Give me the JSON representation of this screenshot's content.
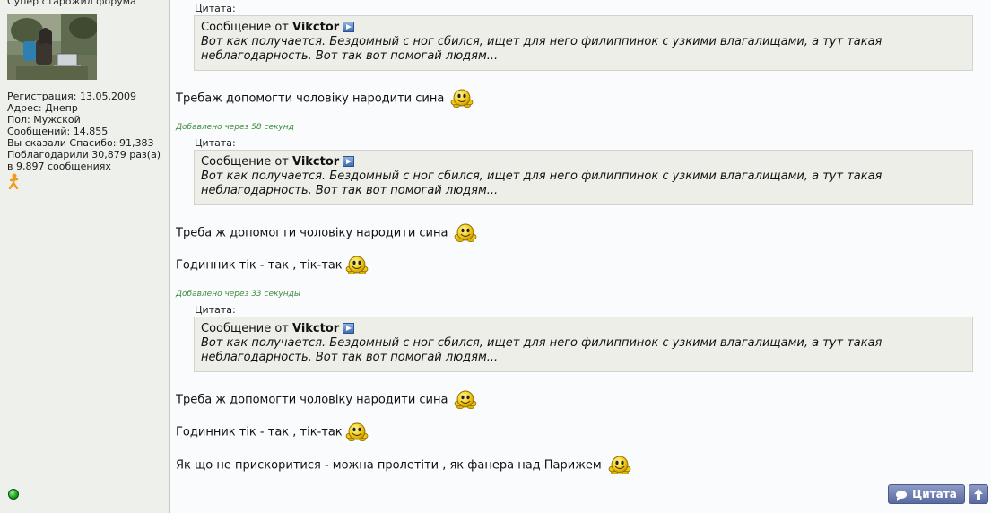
{
  "sidebar": {
    "user_title": "Супер старожил форума",
    "stats": [
      "Регистрация: 13.05.2009",
      "Адрес: Днепр",
      "Пол: Мужской",
      "Сообщений: 14,855",
      "Вы сказали Спасибо: 91,383",
      "Поблагодарили 30,879 раз(а)",
      "в 9,897 сообщениях"
    ]
  },
  "post": {
    "quotes": [
      {
        "label": "Цитата:",
        "prefix": "Сообщение от",
        "author": "Vikctor",
        "line1": "Вот как получается. Бездомный с ног сбился, ищет для него филиппинок с узкими влагалищами, а тут такая",
        "line2": "неблагодарность. Вот так вот помогай людям..."
      },
      {
        "label": "Цитата:",
        "prefix": "Сообщение от",
        "author": "Vikctor",
        "line1": "Вот как получается. Бездомный с ног сбился, ищет для него филиппинок с узкими влагалищами, а тут такая",
        "line2": "неблагодарность. Вот так вот помогай людям..."
      },
      {
        "label": "Цитата:",
        "prefix": "Сообщение от",
        "author": "Vikctor",
        "line1": "Вот как получается. Бездомный с ног сбился, ищет для него филиппинок с узкими влагалищами, а тут такая",
        "line2": "неблагодарность. Вот так вот помогай людям..."
      }
    ],
    "messages": [
      "Требаж допомогти чоловіку народити сина",
      "Треба ж допомогти чоловіку народити сина",
      "Годинник тік - так , тік-так",
      "Треба ж допомогти чоловіку народити сина",
      "Годинник тік - так , тік-так",
      "Як що не прискоритися - можна пролетіти , як фанера над Парижем"
    ],
    "added_notes": [
      "Добавлено через 58 секунд",
      "Добавлено через 33 секунды"
    ]
  },
  "buttons": {
    "quote_label": "Цитата"
  },
  "icons": {
    "view_post": "view-post-arrow-icon",
    "smiley": "laughing-smiley-icon",
    "online": "online-status-icon",
    "reputation": "reputation-figure-icon",
    "top": "arrow-up-icon"
  },
  "colors": {
    "added_note": "#3d8b3d",
    "quote_bg": "#eeeee8",
    "sidebar_bg": "#eef0ec",
    "button": "#6a79ad"
  }
}
